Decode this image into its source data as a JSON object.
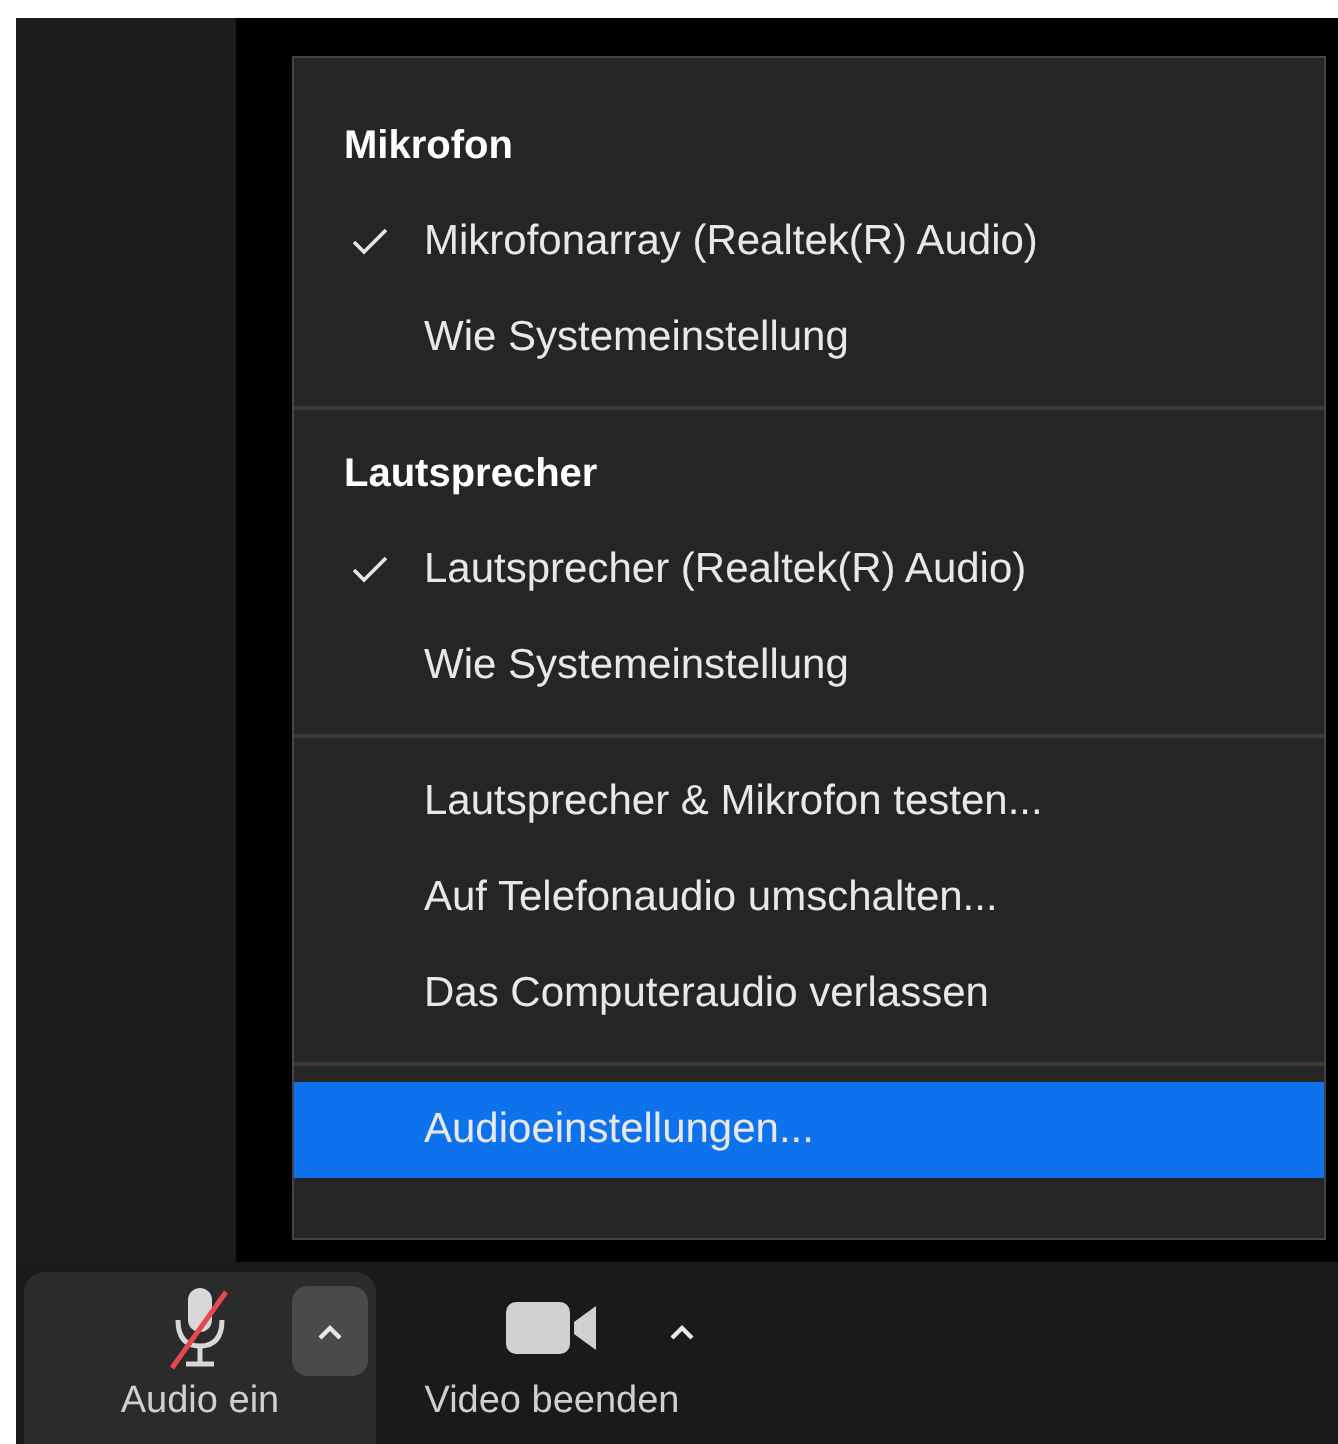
{
  "audio_menu": {
    "sections": [
      {
        "title": "Mikrofon",
        "items": [
          {
            "label": "Mikrofonarray (Realtek(R) Audio)",
            "checked": true,
            "selected": false
          },
          {
            "label": "Wie Systemeinstellung",
            "checked": false,
            "selected": false
          }
        ]
      },
      {
        "title": "Lautsprecher",
        "items": [
          {
            "label": "Lautsprecher (Realtek(R) Audio)",
            "checked": true,
            "selected": false
          },
          {
            "label": "Wie Systemeinstellung",
            "checked": false,
            "selected": false
          }
        ]
      },
      {
        "items": [
          {
            "label": "Lautsprecher & Mikrofon testen...",
            "checked": false,
            "selected": false
          },
          {
            "label": "Auf Telefonaudio umschalten...",
            "checked": false,
            "selected": false
          },
          {
            "label": "Das Computeraudio verlassen",
            "checked": false,
            "selected": false
          }
        ]
      },
      {
        "items": [
          {
            "label": "Audioeinstellungen...",
            "checked": false,
            "selected": true
          }
        ]
      }
    ]
  },
  "toolbar": [
    {
      "kind": "audio",
      "label": "Audio ein",
      "muted": true,
      "selected": true
    },
    {
      "kind": "video",
      "label": "Video beenden",
      "selected": false
    }
  ]
}
